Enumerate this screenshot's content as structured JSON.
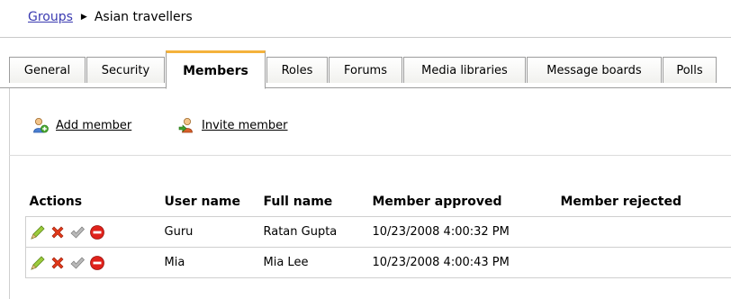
{
  "breadcrumb": {
    "parent": "Groups",
    "current": "Asian travellers"
  },
  "tabs": [
    {
      "label": "General"
    },
    {
      "label": "Security"
    },
    {
      "label": "Members"
    },
    {
      "label": "Roles"
    },
    {
      "label": "Forums"
    },
    {
      "label": "Media libraries"
    },
    {
      "label": "Message boards"
    },
    {
      "label": "Polls"
    }
  ],
  "active_tab": "Members",
  "toolbar": {
    "add_member": "Add member",
    "invite_member": "Invite member"
  },
  "table": {
    "headers": {
      "actions": "Actions",
      "user_name": "User name",
      "full_name": "Full name",
      "member_approved": "Member approved",
      "member_rejected": "Member rejected"
    },
    "rows": [
      {
        "user_name": "Guru",
        "full_name": "Ratan Gupta",
        "member_approved": "10/23/2008 4:00:32 PM",
        "member_rejected": ""
      },
      {
        "user_name": "Mia",
        "full_name": "Mia Lee",
        "member_approved": "10/23/2008 4:00:43 PM",
        "member_rejected": ""
      }
    ]
  },
  "icons": [
    "edit-icon",
    "delete-icon",
    "approve-icon",
    "reject-icon"
  ],
  "colors": {
    "link": "#3b3bb1",
    "active_tab_accent": "#f4b23c",
    "delete": "#e33a1a",
    "reject": "#e0221b",
    "edit": "#8dbb2f"
  }
}
